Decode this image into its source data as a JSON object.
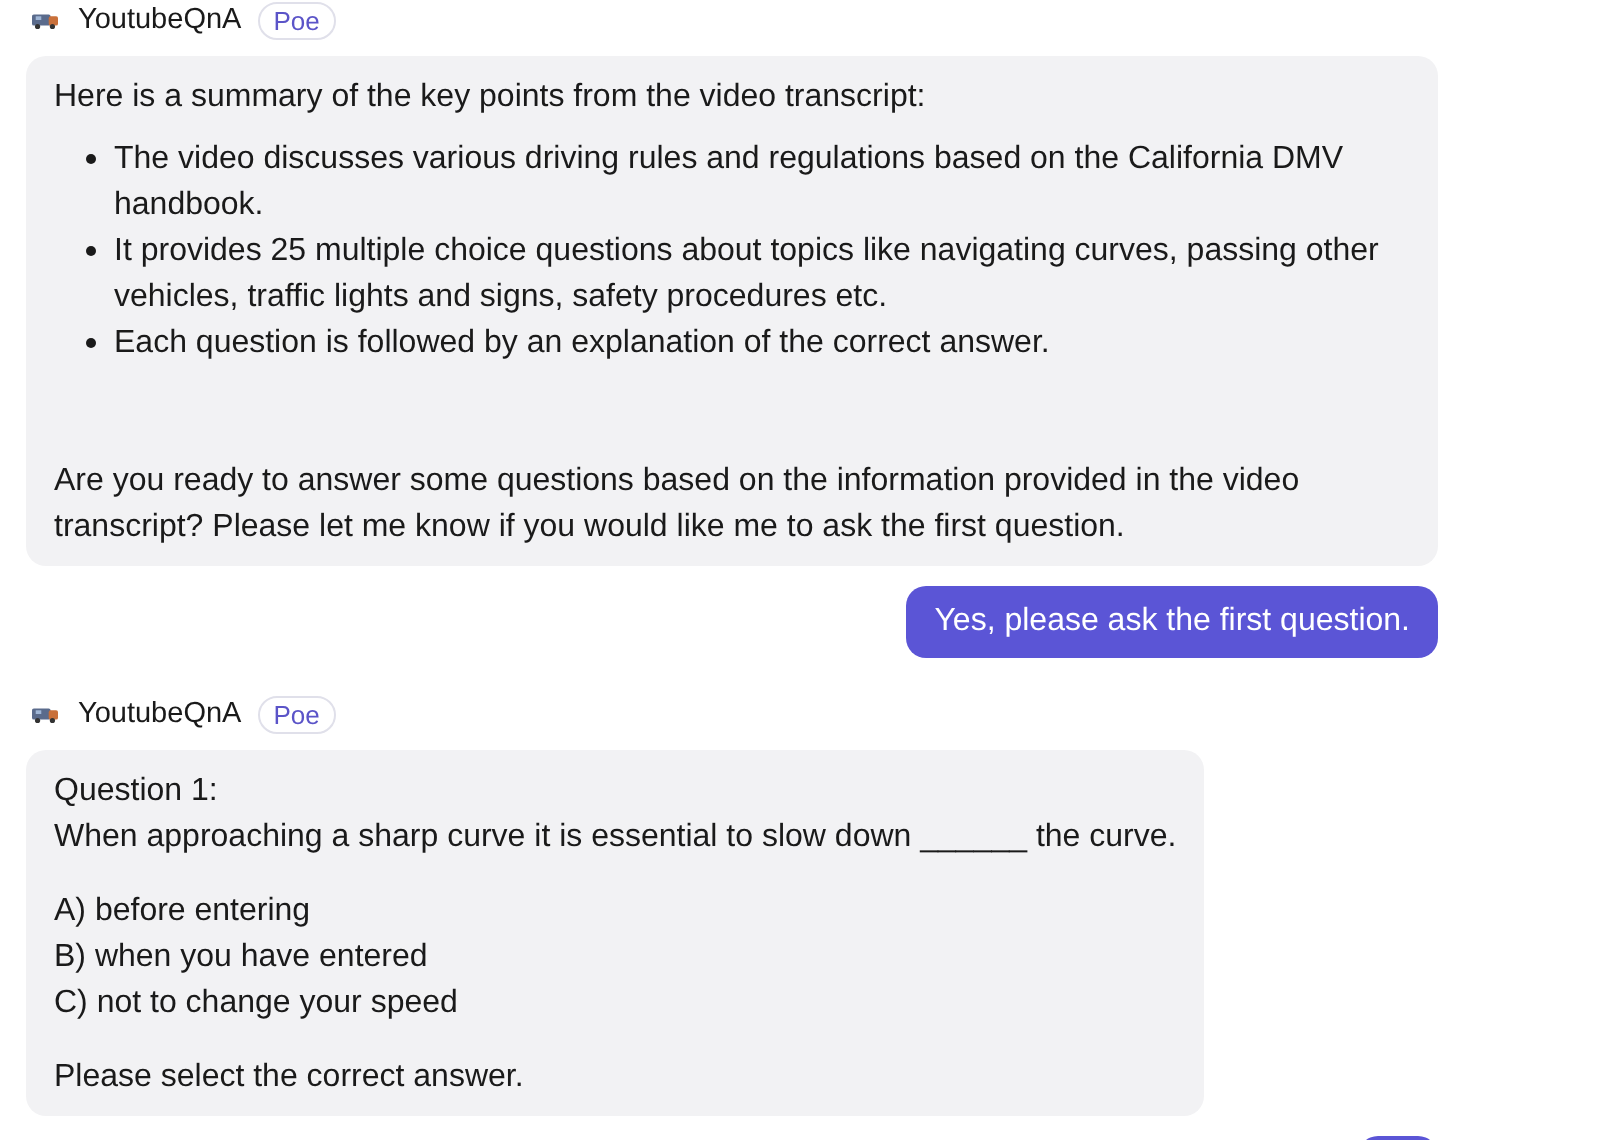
{
  "messages": [
    {
      "kind": "bot",
      "sender": "YoutubeQnA",
      "badge": "Poe",
      "blocks": [
        {
          "kind": "paragraph",
          "text": "Here is a summary of the key points from the video transcript:"
        },
        {
          "kind": "bullets",
          "items": [
            "The video discusses various driving rules and regulations based on the California DMV handbook.",
            "It provides 25 multiple choice questions about topics like navigating curves, passing other vehicles, traffic lights and signs, safety procedures etc.",
            "Each question is followed by an explanation of the correct answer."
          ]
        },
        {
          "kind": "paragraph",
          "text": "Are you ready to answer some questions based on the information provided in the video transcript? Please let me know if you would like me to ask the first question."
        }
      ]
    },
    {
      "kind": "user",
      "text": "Yes, please ask the first question."
    },
    {
      "kind": "bot",
      "sender": "YoutubeQnA",
      "badge": "Poe",
      "blocks": [
        {
          "kind": "lines",
          "lines": [
            "Question 1:",
            "When approaching a sharp curve it is essential to slow down ______ the curve."
          ]
        },
        {
          "kind": "lines",
          "lines": [
            "A) before entering",
            "B) when you have entered",
            "C) not to change your speed"
          ]
        },
        {
          "kind": "paragraph",
          "text": "Please select the correct answer."
        }
      ]
    },
    {
      "kind": "user"
    }
  ]
}
